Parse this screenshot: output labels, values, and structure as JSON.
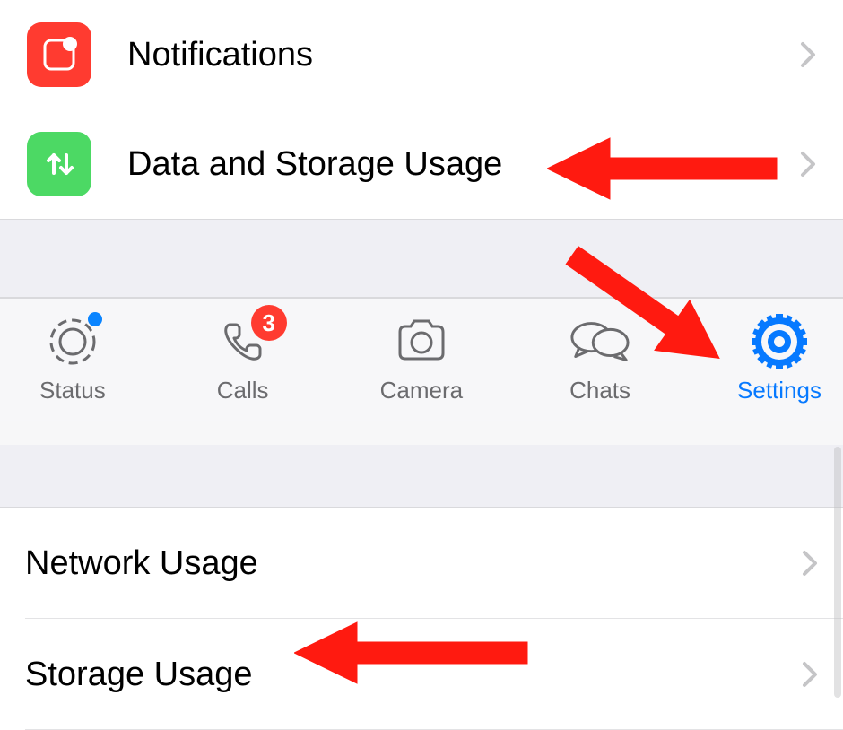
{
  "settings": {
    "notifications": {
      "label": "Notifications"
    },
    "dataStorage": {
      "label": "Data and Storage Usage"
    }
  },
  "tabs": {
    "status": {
      "label": "Status"
    },
    "calls": {
      "label": "Calls",
      "badge": "3"
    },
    "camera": {
      "label": "Camera"
    },
    "chats": {
      "label": "Chats"
    },
    "settings": {
      "label": "Settings",
      "active": true
    }
  },
  "usage": {
    "network": {
      "label": "Network Usage"
    },
    "storage": {
      "label": "Storage Usage"
    }
  }
}
